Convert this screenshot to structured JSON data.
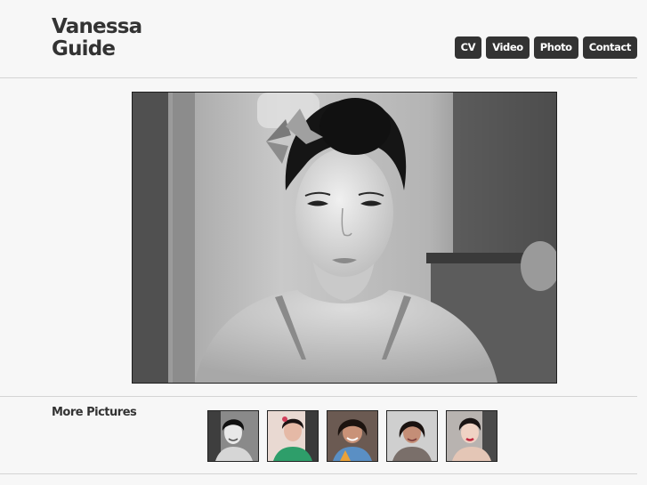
{
  "header": {
    "title_line1": "Vanessa",
    "title_line2": "Guide",
    "nav": [
      {
        "label": "CV"
      },
      {
        "label": "Video"
      },
      {
        "label": "Photo"
      },
      {
        "label": "Contact"
      }
    ]
  },
  "more_pictures": {
    "heading": "More Pictures",
    "thumbnail_count": 5
  }
}
